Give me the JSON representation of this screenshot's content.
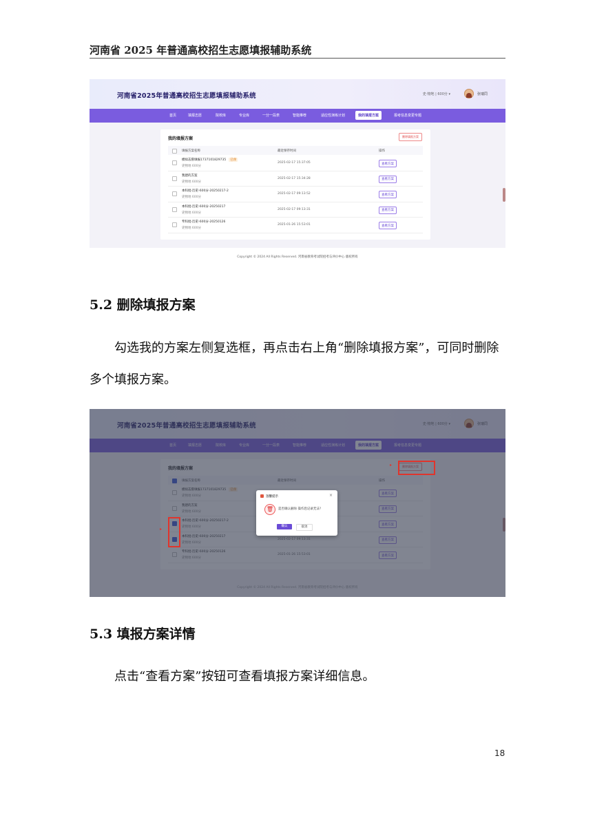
{
  "header": {
    "title": "河南省 2025 年普通高校招生志愿填报辅助系统"
  },
  "app": {
    "title": "河南省2025年普通高校招生志愿填报辅助系统",
    "user_info": "史·物地 | 600分 ▾",
    "username": "张瑞同",
    "nav": [
      "首页",
      "填报志愿",
      "院校库",
      "专业库",
      "一分一段表",
      "智能推荐",
      "适应性演练计划",
      "我的填报方案",
      "报考信息变更专题"
    ],
    "card_title": "我的填报方案",
    "delete_button": "删除填报方案",
    "table_headers": [
      "填报方案名称",
      "最近保存时间",
      "操作"
    ],
    "rows": [
      {
        "name": "模拟志愿填报1737101829735",
        "tag": "已保",
        "sub": "史物地 600分",
        "time": "2025-02-17 15:37:05",
        "action": "查看方案"
      },
      {
        "name": "我建的方案",
        "tag": "",
        "sub": "史物地 600分",
        "time": "2025-02-17 15:34:28",
        "action": "查看方案"
      },
      {
        "name": "本科批-历史-600分-20250217-2",
        "tag": "",
        "sub": "史物地 600分",
        "time": "2025-02-17 09:13:52",
        "action": "查看方案"
      },
      {
        "name": "本科批-历史-600分-20250217",
        "tag": "",
        "sub": "史物地 600分",
        "time": "2025-02-17 09:13:31",
        "action": "查看方案"
      },
      {
        "name": "专科批-历史-600分-20250126",
        "tag": "",
        "sub": "史物地 600分",
        "time": "2025-01-26 15:53:01",
        "action": "查看方案"
      }
    ],
    "copyright": "Copyright © 2024 All Rights Reserved. 河南省教育考试院招考与评价中心 版权所有"
  },
  "dialog": {
    "title": "温馨提示",
    "message": "是否确认删除 操作后记录无法?",
    "ok": "确认",
    "cancel": "取消",
    "close": "×"
  },
  "section_52": {
    "heading": "5.2 删除填报方案",
    "paragraph": "勾选我的方案左侧复选框，再点击右上角“删除填报方案”，可同时删除多个填报方案。"
  },
  "section_53": {
    "heading": "5.3 填报方案详情",
    "paragraph": "点击“查看方案”按钮可查看填报方案详细信息。"
  },
  "page_number": "18",
  "colors": {
    "nav": "#7a5cdf",
    "accent": "#6a4bd6",
    "highlight": "#e0342c"
  }
}
